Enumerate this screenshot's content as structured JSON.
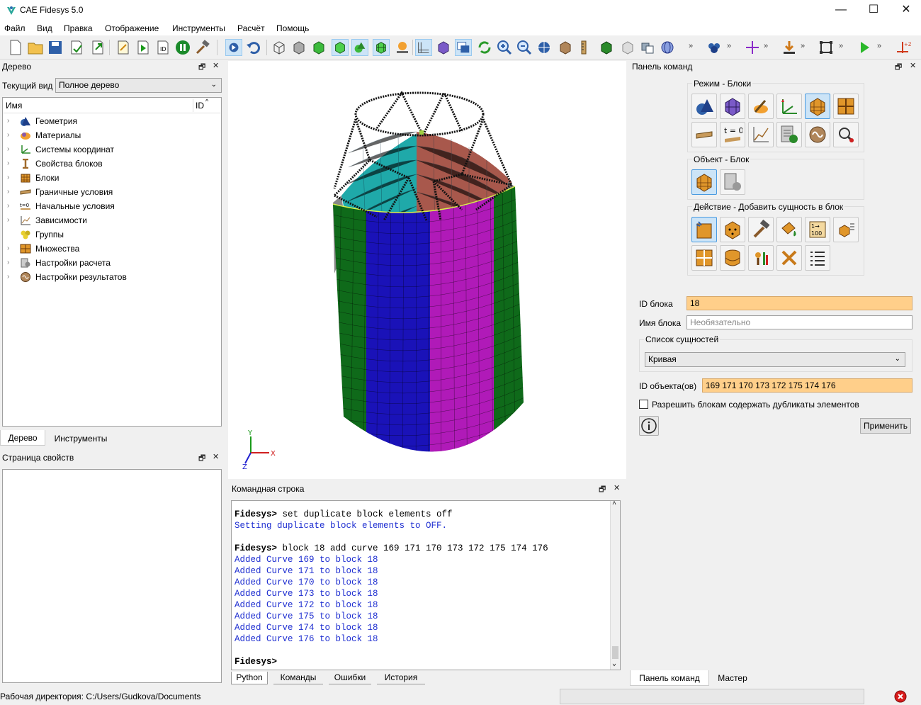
{
  "window": {
    "title": "CAE Fidesys 5.0",
    "minimize": "—",
    "maximize": "☐",
    "close": "✕"
  },
  "menu": [
    "Файл",
    "Вид",
    "Правка",
    "Отображение",
    "Инструменты",
    "Расчёт",
    "Помощь"
  ],
  "tree_panel": {
    "title": "Дерево",
    "current_view_label": "Текущий вид",
    "current_view_value": "Полное дерево",
    "col_name": "Имя",
    "col_id": "ID",
    "items": [
      {
        "label": "Геометрия",
        "icon": "geometry-icon"
      },
      {
        "label": "Материалы",
        "icon": "materials-icon"
      },
      {
        "label": "Системы координат",
        "icon": "coordinate-systems-icon"
      },
      {
        "label": "Свойства блоков",
        "icon": "block-properties-icon"
      },
      {
        "label": "Блоки",
        "icon": "blocks-icon"
      },
      {
        "label": "Граничные условия",
        "icon": "boundary-conditions-icon"
      },
      {
        "label": "Начальные условия",
        "icon": "initial-conditions-icon"
      },
      {
        "label": "Зависимости",
        "icon": "dependencies-icon"
      },
      {
        "label": "Группы",
        "icon": "groups-icon"
      },
      {
        "label": "Множества",
        "icon": "sets-icon"
      },
      {
        "label": "Настройки расчета",
        "icon": "calc-settings-icon"
      },
      {
        "label": "Настройки результатов",
        "icon": "result-settings-icon"
      }
    ],
    "tabs": [
      "Дерево",
      "Инструменты"
    ]
  },
  "properties_panel": {
    "title": "Страница свойств"
  },
  "command_line": {
    "title": "Командная строка",
    "lines": [
      {
        "type": "prompt",
        "text": "Fidesys> set duplicate block elements off"
      },
      {
        "type": "out",
        "text": "Setting duplicate block elements to OFF."
      },
      {
        "type": "blank",
        "text": ""
      },
      {
        "type": "prompt",
        "text": "Fidesys> block 18 add curve 169 171 170 173 172 175 174 176"
      },
      {
        "type": "out",
        "text": "Added Curve 169 to block 18"
      },
      {
        "type": "out",
        "text": "Added Curve 171 to block 18"
      },
      {
        "type": "out",
        "text": "Added Curve 170 to block 18"
      },
      {
        "type": "out",
        "text": "Added Curve 173 to block 18"
      },
      {
        "type": "out",
        "text": "Added Curve 172 to block 18"
      },
      {
        "type": "out",
        "text": "Added Curve 175 to block 18"
      },
      {
        "type": "out",
        "text": "Added Curve 174 to block 18"
      },
      {
        "type": "out",
        "text": "Added Curve 176 to block 18"
      },
      {
        "type": "blank",
        "text": ""
      },
      {
        "type": "prompt",
        "text": "Fidesys>"
      }
    ],
    "tabs": [
      "Python",
      "Команды",
      "Ошибки",
      "История"
    ]
  },
  "command_panel": {
    "title": "Панель команд",
    "mode_label": "Режим - Блоки",
    "object_label": "Объект - Блок",
    "action_label": "Действие - Добавить сущность в блок",
    "block_id_label": "ID блока",
    "block_id_value": "18",
    "block_name_label": "Имя блока",
    "block_name_placeholder": "Необязательно",
    "entity_list_label": "Список сущностей",
    "entity_type_value": "Кривая",
    "object_ids_label": "ID объекта(ов)",
    "object_ids_value": "169 171 170 173 172 175 174 176",
    "allow_duplicates_label": "Разрешить блокам содержать дубликаты элементов",
    "apply_label": "Применить",
    "tabs": [
      "Панель команд",
      "Мастер"
    ]
  },
  "viewport": {
    "axis_x": "X",
    "axis_y": "Y",
    "axis_z": "Z"
  },
  "status": {
    "working_dir": "Рабочая директория: C:/Users/Gudkova/Documents"
  },
  "colors": {
    "accent_orange": "#ffcf8a",
    "mesh_blue": "#1a12b8",
    "mesh_magenta": "#b01ab8",
    "mesh_green": "#0f6a1a",
    "mesh_teal": "#1fa9a9",
    "mesh_brown": "#a8584c",
    "cmd_output": "#1f2fd1"
  }
}
